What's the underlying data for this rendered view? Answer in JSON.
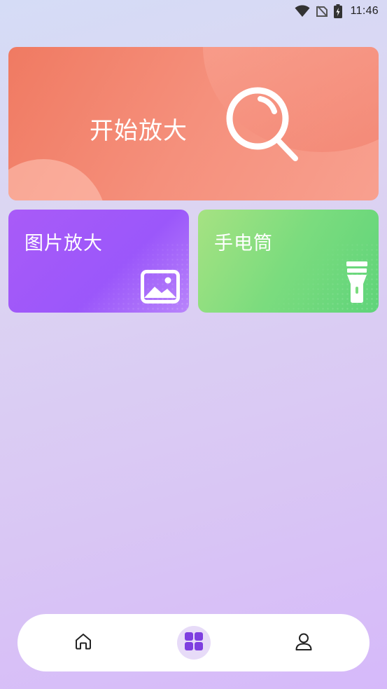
{
  "status_bar": {
    "time": "11:46",
    "icons": [
      "wifi-icon",
      "no-signal-icon",
      "battery-charging-icon"
    ]
  },
  "cards": {
    "magnify": {
      "title": "开始放大",
      "icon": "magnifier-icon"
    },
    "image_zoom": {
      "title": "图片放大",
      "icon": "image-icon"
    },
    "flashlight": {
      "title": "手电筒",
      "icon": "flashlight-icon"
    }
  },
  "tabbar": {
    "tabs": [
      {
        "icon": "home-icon",
        "active": false
      },
      {
        "icon": "grid-icon",
        "active": true
      },
      {
        "icon": "user-icon",
        "active": false
      }
    ]
  },
  "colors": {
    "magnify_card": "#f07a62",
    "image_card": "#a95bf8",
    "flashlight_card": "#7bdc7e",
    "active_tab_bg": "#e7dbf8",
    "active_tab_icon": "#7e3ee0"
  }
}
